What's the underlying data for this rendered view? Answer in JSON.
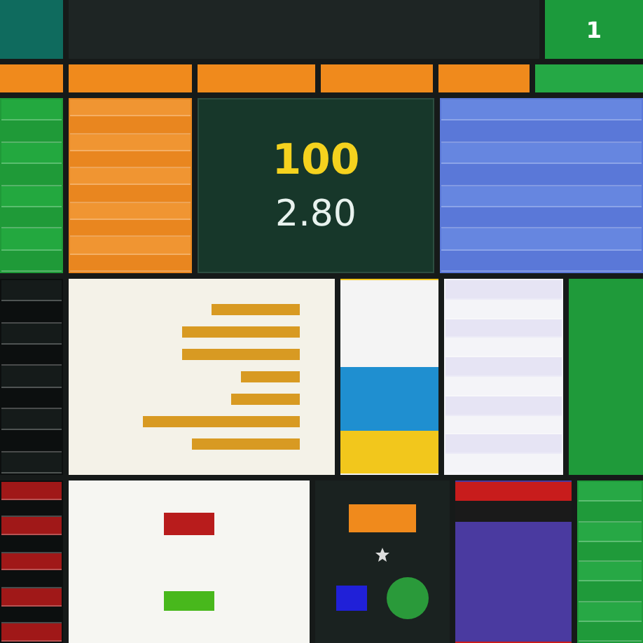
{
  "header": {
    "counter": "1"
  },
  "tabs": [
    {
      "selected": false
    },
    {
      "selected": false
    },
    {
      "selected": false
    },
    {
      "selected": false
    },
    {
      "selected": false
    },
    {
      "selected": true
    }
  ],
  "metrics": [
    {
      "kind": "primary",
      "value": "100"
    },
    {
      "kind": "secondary",
      "value": "2.80"
    }
  ]
}
